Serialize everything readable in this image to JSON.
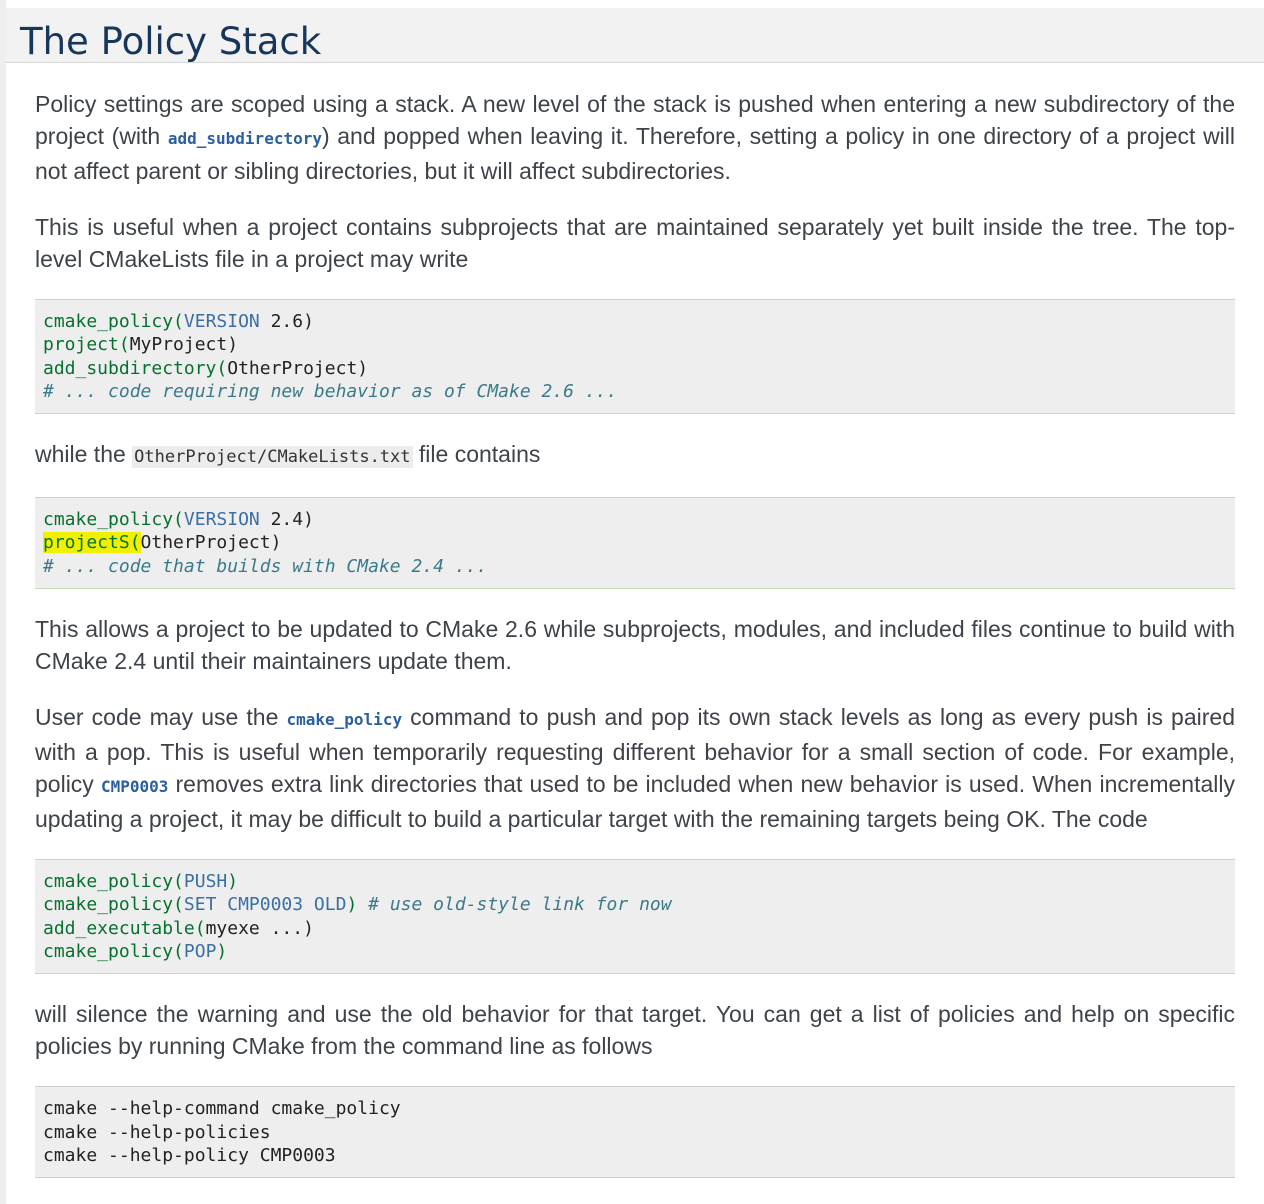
{
  "title": "The Policy Stack",
  "p1": {
    "a": "Policy settings are scoped using a stack. A new level of the stack is pushed when entering a new subdirectory of the project (with ",
    "ref": "add_subdirectory",
    "b": ") and popped when leaving it. Therefore, setting a policy in one directory of a project will not affect parent or sibling directories, but it will affect subdirectories."
  },
  "p2": "This is useful when a project contains subprojects that are maintained separately yet built inside the tree. The top-level CMakeLists file in a project may write",
  "code1": {
    "l1_fn": "cmake_policy(",
    "l1_kw": "VERSION",
    "l1_rest": " 2.6)",
    "l2_fn": "project(",
    "l2_rest": "MyProject)",
    "l3_fn": "add_subdirectory(",
    "l3_rest": "OtherProject)",
    "l4_comment": "# ... code requiring new behavior as of CMake 2.6 ..."
  },
  "p3": {
    "a": "while the ",
    "lit": "OtherProject/CMakeLists.txt",
    "b": " file contains"
  },
  "code2": {
    "l1_fn": "cmake_policy(",
    "l1_kw": "VERSION",
    "l1_rest": " 2.4)",
    "l2_hl": "projectS(",
    "l2_rest": "OtherProject)",
    "l3_comment": "# ... code that builds with CMake 2.4 ..."
  },
  "p4": "This allows a project to be updated to CMake 2.6 while subprojects, modules, and included files continue to build with CMake 2.4 until their maintainers update them.",
  "p5": {
    "a": "User code may use the ",
    "ref1": "cmake_policy",
    "b": " command to push and pop its own stack levels as long as every push is paired with a pop. This is useful when temporarily requesting different behavior for a small section of code. For example, policy ",
    "ref2": "CMP0003",
    "c": " removes extra link directories that used to be included when new behavior is used. When incrementally updating a project, it may be difficult to build a particular target with the remaining targets being OK. The code"
  },
  "code3": {
    "l1_fn": "cmake_policy(",
    "l1_kw": "PUSH",
    "l1_rest": ")",
    "l2_fn": "cmake_policy(",
    "l2_kw": "SET CMP0003 OLD",
    "l2_rest": ") ",
    "l2_comment": "# use old-style link for now",
    "l3_fn": "add_executable(",
    "l3_rest": "myexe ...)",
    "l4_fn": "cmake_policy(",
    "l4_kw": "POP",
    "l4_rest": ")"
  },
  "p6": "will silence the warning and use the old behavior for that target. You can get a list of policies and help on specific policies by running CMake from the command line as follows",
  "code4": {
    "l1": "cmake --help-command cmake_policy",
    "l2": "cmake --help-policies",
    "l3": "cmake --help-policy CMP0003"
  }
}
